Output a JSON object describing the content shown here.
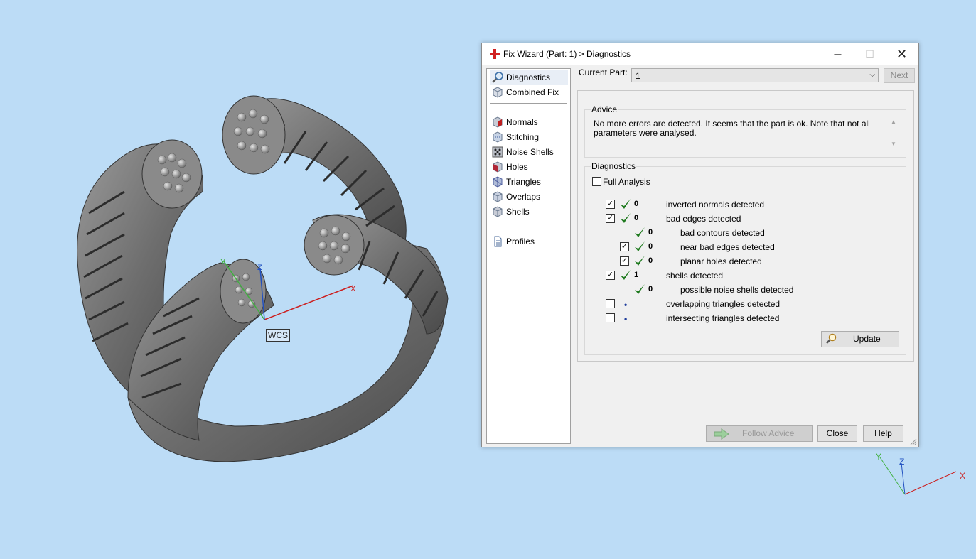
{
  "viewport": {
    "wcs_label": "WCS",
    "axis_labels": {
      "x": "X",
      "y": "Y",
      "z": "Z"
    },
    "colors": {
      "background": "#bcdcf6",
      "model": "#7c7c7c",
      "x_axis": "#cc2020",
      "y_axis": "#40b040",
      "z_axis": "#2050c0"
    }
  },
  "window": {
    "title": "Fix Wizard (Part: 1) > Diagnostics",
    "controls": {
      "minimize": "─",
      "maximize": "☐",
      "close": "✕"
    }
  },
  "nav": {
    "items": [
      {
        "label": "Diagnostics",
        "icon": "magnifier-icon"
      },
      {
        "label": "Combined Fix",
        "icon": "cube-icon"
      },
      {
        "label": "Normals",
        "icon": "normals-cube-icon"
      },
      {
        "label": "Stitching",
        "icon": "stitching-cube-icon"
      },
      {
        "label": "Noise Shells",
        "icon": "noise-shells-icon"
      },
      {
        "label": "Holes",
        "icon": "holes-cube-icon"
      },
      {
        "label": "Triangles",
        "icon": "triangles-cube-icon"
      },
      {
        "label": "Overlaps",
        "icon": "overlaps-cube-icon"
      },
      {
        "label": "Shells",
        "icon": "shells-cube-icon"
      },
      {
        "label": "Profiles",
        "icon": "document-icon"
      }
    ]
  },
  "current_part": {
    "label": "Current Part:",
    "value": "1",
    "next_label": "Next"
  },
  "advice": {
    "title": "Advice",
    "text": "No more errors are detected. It seems that the part is ok. Note that not all parameters were analysed."
  },
  "diagnostics": {
    "title": "Diagnostics",
    "full_analysis_label": "Full Analysis",
    "rows": [
      {
        "checkbox": true,
        "checked": true,
        "status": "ok",
        "count": "0",
        "label": "inverted normals detected",
        "indent": 0
      },
      {
        "checkbox": true,
        "checked": true,
        "status": "ok",
        "count": "0",
        "label": "bad edges detected",
        "indent": 0
      },
      {
        "checkbox": false,
        "checked": false,
        "status": "ok",
        "count": "0",
        "label": "bad contours detected",
        "indent": 1
      },
      {
        "checkbox": true,
        "checked": true,
        "status": "ok",
        "count": "0",
        "label": "near bad edges detected",
        "indent": 1
      },
      {
        "checkbox": true,
        "checked": true,
        "status": "ok",
        "count": "0",
        "label": "planar holes detected",
        "indent": 1
      },
      {
        "checkbox": true,
        "checked": true,
        "status": "ok",
        "count": "1",
        "label": "shells detected",
        "indent": 0
      },
      {
        "checkbox": false,
        "checked": false,
        "status": "ok",
        "count": "0",
        "label": "possible noise shells detected",
        "indent": 1
      },
      {
        "checkbox": true,
        "checked": false,
        "status": "pending",
        "count": "",
        "label": "overlapping triangles detected",
        "indent": 0
      },
      {
        "checkbox": true,
        "checked": false,
        "status": "pending",
        "count": "",
        "label": "intersecting triangles detected",
        "indent": 0
      }
    ],
    "update_label": "Update"
  },
  "footer": {
    "follow_label": "Follow Advice",
    "close_label": "Close",
    "help_label": "Help"
  },
  "colors": {
    "check_green": "#1f7a1f",
    "dot_blue": "#1e3c9c",
    "title_icon": "#d02020"
  }
}
